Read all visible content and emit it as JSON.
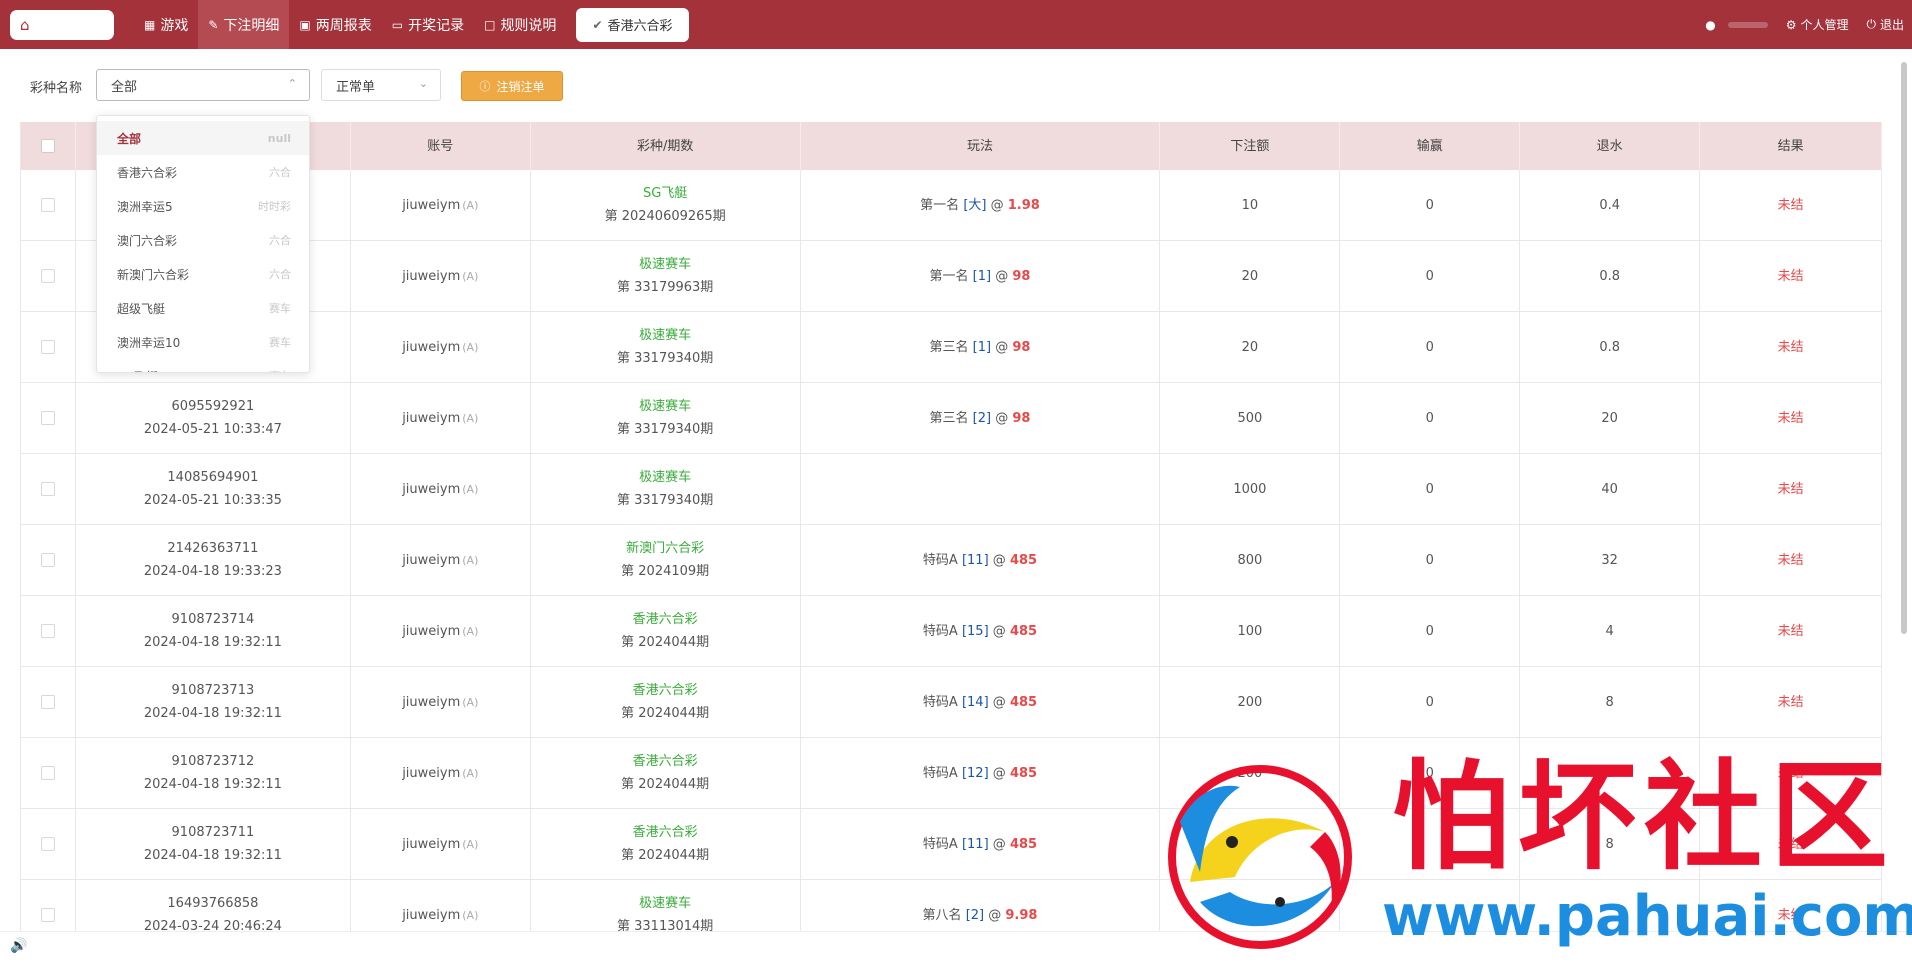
{
  "nav": {
    "home_icon": "home-icon",
    "items": [
      {
        "label": "游戏",
        "icon": "grid-icon"
      },
      {
        "label": "下注明细",
        "icon": "edit-icon",
        "active": true
      },
      {
        "label": "两周报表",
        "icon": "calendar-icon"
      },
      {
        "label": "开奖记录",
        "icon": "monitor-icon"
      },
      {
        "label": "规则说明",
        "icon": "chat-icon"
      }
    ],
    "current_tag": "香港六合彩",
    "profile_label": "个人管理",
    "logout_label": "退出"
  },
  "filter": {
    "lottery_label": "彩种名称",
    "lottery_value": "全部",
    "type_value": "正常单",
    "cancel_button": "注销注单"
  },
  "dropdown": [
    {
      "name": "全部",
      "type": "null"
    },
    {
      "name": "香港六合彩",
      "type": "六合"
    },
    {
      "name": "澳洲幸运5",
      "type": "时时彩"
    },
    {
      "name": "澳门六合彩",
      "type": "六合"
    },
    {
      "name": "新澳门六合彩",
      "type": "六合"
    },
    {
      "name": "超级飞艇",
      "type": "赛车"
    },
    {
      "name": "澳洲幸运10",
      "type": "赛车"
    },
    {
      "name": "SG飞艇",
      "type": "赛车"
    }
  ],
  "table": {
    "headers": [
      "",
      "",
      "账号",
      "彩种/期数",
      "玩法",
      "下注额",
      "输赢",
      "退水",
      "结果"
    ],
    "rows": [
      {
        "id": "",
        "time": "",
        "account": "jiuweiym",
        "acct_tag": "(A)",
        "lottery": "SG飞艇",
        "period": "第 20240609265期",
        "play": "第一名",
        "sel": "[大]",
        "odds": "1.98",
        "amount": "10",
        "winloss": "0",
        "rebate": "0.4",
        "result": "未结"
      },
      {
        "id": "",
        "time": "",
        "account": "jiuweiym",
        "acct_tag": "(A)",
        "lottery": "极速赛车",
        "period": "第 33179963期",
        "play": "第一名",
        "sel": "[1]",
        "odds": "98",
        "amount": "20",
        "winloss": "0",
        "rebate": "0.8",
        "result": "未结"
      },
      {
        "id": "",
        "time": "",
        "account": "jiuweiym",
        "acct_tag": "(A)",
        "lottery": "极速赛车",
        "period": "第 33179340期",
        "play": "第三名",
        "sel": "[1]",
        "odds": "98",
        "amount": "20",
        "winloss": "0",
        "rebate": "0.8",
        "result": "未结"
      },
      {
        "id": "6095592921",
        "time": "2024-05-21 10:33:47",
        "account": "jiuweiym",
        "acct_tag": "(A)",
        "lottery": "极速赛车",
        "period": "第 33179340期",
        "play": "第三名",
        "sel": "[2]",
        "odds": "98",
        "amount": "500",
        "winloss": "0",
        "rebate": "20",
        "result": "未结"
      },
      {
        "id": "14085694901",
        "time": "2024-05-21 10:33:35",
        "account": "jiuweiym",
        "acct_tag": "(A)",
        "lottery": "极速赛车",
        "period": "第 33179340期",
        "play": "",
        "sel": "",
        "odds": "",
        "amount": "1000",
        "winloss": "0",
        "rebate": "40",
        "result": "未结"
      },
      {
        "id": "21426363711",
        "time": "2024-04-18 19:33:23",
        "account": "jiuweiym",
        "acct_tag": "(A)",
        "lottery": "新澳门六合彩",
        "period": "第 2024109期",
        "play": "特码A",
        "sel": "[11]",
        "odds": "485",
        "amount": "800",
        "winloss": "0",
        "rebate": "32",
        "result": "未结"
      },
      {
        "id": "9108723714",
        "time": "2024-04-18 19:32:11",
        "account": "jiuweiym",
        "acct_tag": "(A)",
        "lottery": "香港六合彩",
        "period": "第 2024044期",
        "play": "特码A",
        "sel": "[15]",
        "odds": "485",
        "amount": "100",
        "winloss": "0",
        "rebate": "4",
        "result": "未结"
      },
      {
        "id": "9108723713",
        "time": "2024-04-18 19:32:11",
        "account": "jiuweiym",
        "acct_tag": "(A)",
        "lottery": "香港六合彩",
        "period": "第 2024044期",
        "play": "特码A",
        "sel": "[14]",
        "odds": "485",
        "amount": "200",
        "winloss": "0",
        "rebate": "8",
        "result": "未结"
      },
      {
        "id": "9108723712",
        "time": "2024-04-18 19:32:11",
        "account": "jiuweiym",
        "acct_tag": "(A)",
        "lottery": "香港六合彩",
        "period": "第 2024044期",
        "play": "特码A",
        "sel": "[12]",
        "odds": "485",
        "amount": "200",
        "winloss": "0",
        "rebate": "8",
        "result": "未结"
      },
      {
        "id": "9108723711",
        "time": "2024-04-18 19:32:11",
        "account": "jiuweiym",
        "acct_tag": "(A)",
        "lottery": "香港六合彩",
        "period": "第 2024044期",
        "play": "特码A",
        "sel": "[11]",
        "odds": "485",
        "amount": "",
        "winloss": "",
        "rebate": "8",
        "result": "未结"
      },
      {
        "id": "16493766858",
        "time": "2024-03-24 20:46:24",
        "account": "jiuweiym",
        "acct_tag": "(A)",
        "lottery": "极速赛车",
        "period": "第 33113014期",
        "play": "第八名",
        "sel": "[2]",
        "odds": "9.98",
        "amount": "",
        "winloss": "",
        "rebate": "",
        "result": "未结"
      }
    ]
  },
  "watermark": {
    "title": "怕坏社区",
    "url": "www.pahuai.com"
  },
  "colors": {
    "brand": "#a3323a",
    "header_row": "#f1dcdd",
    "lottery_green": "#3aac3a",
    "odds_red": "#e64a4a",
    "selection_blue": "#1a55a8",
    "cancel_orange": "#efa944"
  }
}
